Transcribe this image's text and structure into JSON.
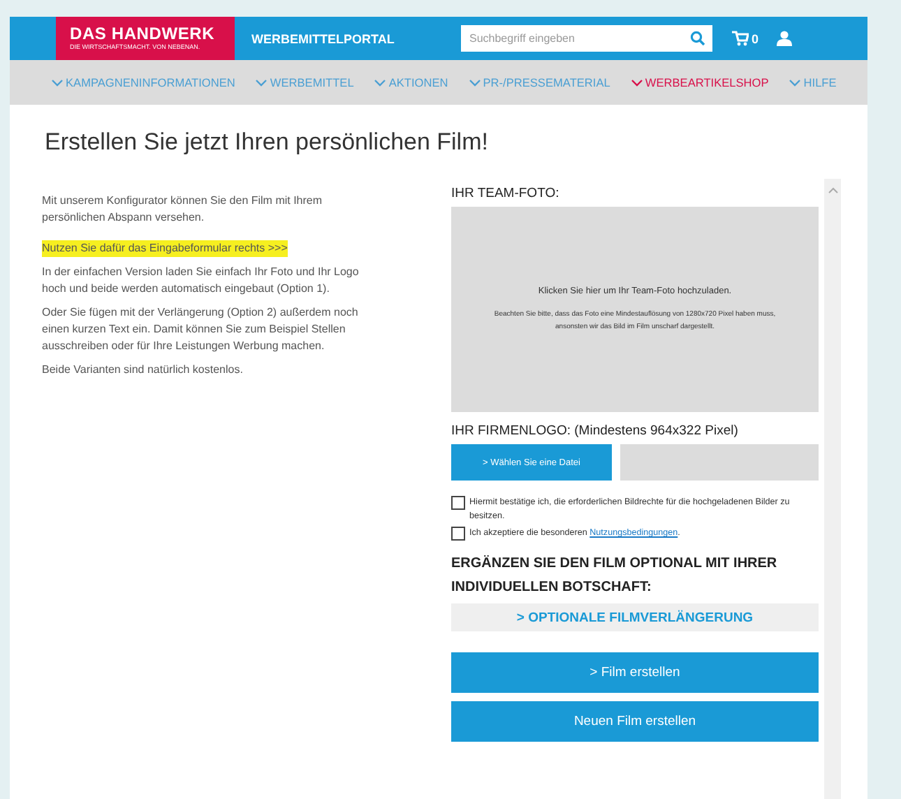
{
  "header": {
    "logo_title": "DAS HANDWERK",
    "logo_subtitle": "DIE WIRTSCHAFTSMACHT. VON NEBENAN.",
    "portal": "WERBEMITTELPORTAL",
    "search": {
      "placeholder": "Suchbegriff eingeben"
    },
    "cart_count": "0"
  },
  "nav": [
    {
      "label": "KAMPAGNENINFORMATIONEN",
      "selected": false
    },
    {
      "label": "WERBEMITTEL",
      "selected": false
    },
    {
      "label": "AKTIONEN",
      "selected": false
    },
    {
      "label": "PR-/PRESSEMATERIAL",
      "selected": false
    },
    {
      "label": "WERBEARTIKELSHOP",
      "selected": true
    },
    {
      "label": "HILFE",
      "selected": false
    }
  ],
  "title": "Erstellen Sie jetzt Ihren persönlichen Film!",
  "intro": [
    {
      "text": "Mit unserem Konfigurator können Sie den Film mit Ihrem persönlichen Abspann versehen.",
      "highlighted": false
    },
    {
      "text": "Nutzen Sie dafür das Eingabeformular rechts >>>",
      "highlighted": true
    },
    {
      "text": "In der einfachen Version laden Sie einfach Ihr Foto und Ihr Logo hoch und beide werden automatisch eingebaut (Option 1).",
      "highlighted": false
    },
    {
      "text": "Oder Sie fügen mit der Verlängerung (Option 2) außerdem noch einen kurzen Text ein. Damit können Sie zum Beispiel Stellen ausschreiben oder für Ihre Leistungen Werbung machen.",
      "highlighted": false
    },
    {
      "text": "Beide Varianten sind natürlich kostenlos.",
      "highlighted": false
    }
  ],
  "form": {
    "photo_heading": "IHR TEAM-FOTO:",
    "upload_prompt": "Klicken Sie hier um Ihr Team-Foto hochzuladen.",
    "upload_note": "Beachten Sie bitte, dass das Foto eine Mindestauflösung von 1280x720 Pixel haben muss, ansonsten wir das Bild im Film unscharf dargestellt.",
    "logo_heading": "IHR FIRMENLOGO: (Mindestens 964x322 Pixel)",
    "file_button": "> Wählen Sie eine Datei",
    "checkboxes": [
      {
        "text": "Hiermit bestätige ich, die erforderlichen Bildrechte für die hochgeladenen Bilder zu besitzen.",
        "checked": false
      },
      {
        "text": "Ich akzeptiere die besonderen ",
        "link": "Nutzungsbedingungen",
        "tail": ".",
        "checked": false
      }
    ],
    "optional_heading": "ERGÄNZEN SIE DEN FILM OPTIONAL MIT IHRER INDIVIDUELLEN BOTSCHAFT:",
    "extension_button": "> OPTIONALE FILMVERLÄNGERUNG",
    "buttons": [
      "> Film erstellen",
      "Neuen Film erstellen"
    ]
  }
}
